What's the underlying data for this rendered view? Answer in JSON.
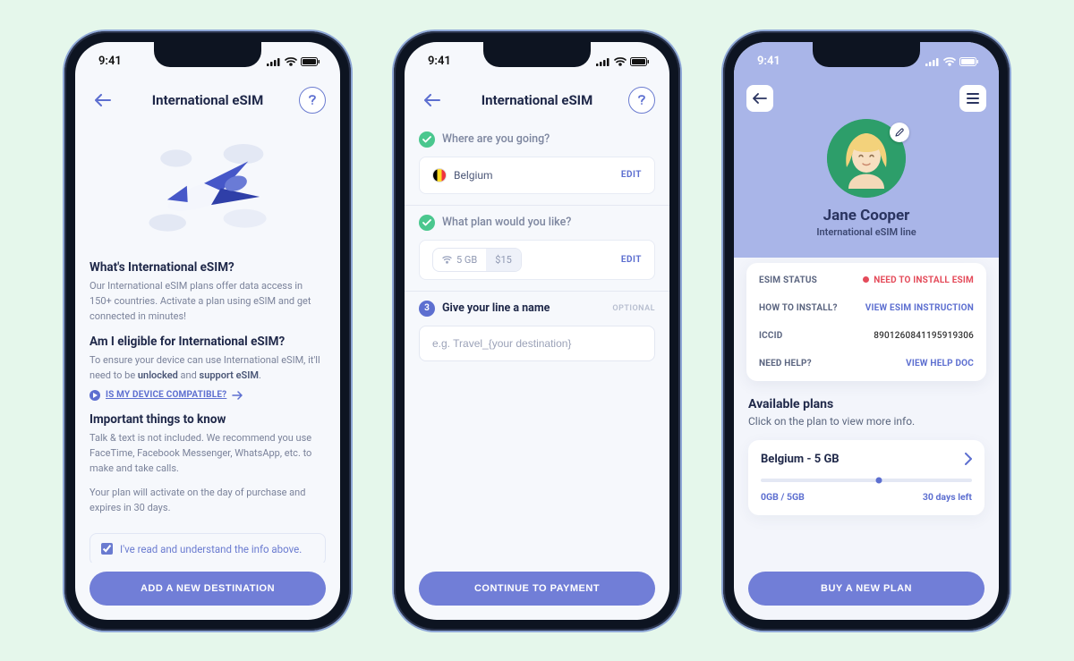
{
  "status_time": "9:41",
  "screen1": {
    "title": "International eSIM",
    "h1": "What's International eSIM?",
    "p1": "Our International eSIM plans offer data access in 150+ countries. Activate a plan using eSIM and get connected in minutes!",
    "h2": "Am I eligible for International eSIM?",
    "p2a": "To ensure your device can use International eSIM, it'll need to be ",
    "p2b": "unlocked",
    "p2c": " and ",
    "p2d": "support eSIM",
    "p2e": ".",
    "compat_link": "IS MY DEVICE COMPATIBLE?",
    "h3": "Important things to know",
    "p3": "Talk & text is not included. We recommend you use FaceTime, Facebook Messenger, WhatsApp, etc. to make and take calls.",
    "p4": "Your plan will activate on the day of purchase and expires in 30 days.",
    "ack_label": "I've read and understand the info above.",
    "cta": "ADD A NEW DESTINATION"
  },
  "screen2": {
    "title": "International eSIM",
    "step1_q": "Where are you going?",
    "step1_val": "Belgium",
    "edit": "EDIT",
    "step2_q": "What plan would you like?",
    "plan_size": "5 GB",
    "plan_price": "$15",
    "step3_q": "Give your line a name",
    "optional": "OPTIONAL",
    "name_placeholder": "e.g. Travel_{your destination}",
    "cta": "CONTINUE TO PAYMENT"
  },
  "screen3": {
    "name": "Jane Cooper",
    "subtitle": "International eSIM line",
    "rows": {
      "status_label": "ESIM STATUS",
      "status_val": "NEED TO INSTALL ESIM",
      "install_label": "HOW TO INSTALL?",
      "install_val": "VIEW ESIM INSTRUCTION",
      "iccid_label": "ICCID",
      "iccid_val": "8901260841195919306",
      "help_label": "NEED HELP?",
      "help_val": "VIEW HELP DOC"
    },
    "plans_title": "Available plans",
    "plans_sub": "Click on the plan to view more info.",
    "plan_name": "Belgium - 5 GB",
    "plan_usage": "0GB / 5GB",
    "plan_days": "30 days left",
    "cta": "BUY A NEW PLAN"
  }
}
